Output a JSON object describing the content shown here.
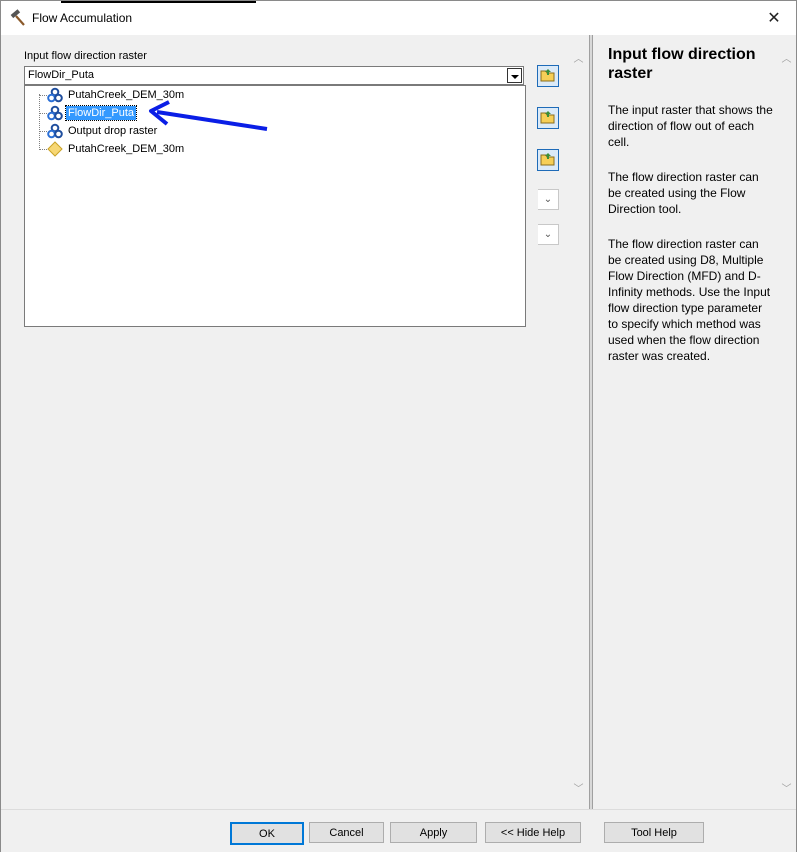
{
  "window": {
    "title": "Flow Accumulation",
    "icons": {
      "title": "hammer-icon",
      "close": "close-icon"
    }
  },
  "form": {
    "input_label": "Input flow direction raster",
    "input_value": "FlowDir_Puta",
    "dropdown_items": [
      {
        "label": "PutahCreek_DEM_30m",
        "icon": "raster-layer-icon",
        "selected": false
      },
      {
        "label": "FlowDir_Puta",
        "icon": "raster-layer-icon",
        "selected": true
      },
      {
        "label": "Output drop raster",
        "icon": "raster-layer-icon",
        "selected": false
      },
      {
        "label": "PutahCreek_DEM_30m",
        "icon": "raster-dataset-icon",
        "selected": false
      }
    ],
    "annotation": {
      "type": "arrow",
      "color": "#0a1ee6",
      "points_to": "FlowDir_Puta"
    }
  },
  "help": {
    "title": "Input flow direction raster",
    "paragraphs": [
      "The input raster that shows the direction of flow out of each cell.",
      "The flow direction raster can be created using the Flow Direction tool.",
      "The flow direction raster can be created using D8, Multiple Flow Direction (MFD) and D-Infinity methods. Use the Input flow direction type parameter to specify which method was used when the flow direction raster was created."
    ]
  },
  "buttons": {
    "ok": "OK",
    "cancel": "Cancel",
    "apply": "Apply",
    "hide_help": "<< Hide Help",
    "tool_help": "Tool Help"
  },
  "colors": {
    "selection": "#3399ff",
    "accent": "#0078d7",
    "arrow": "#0a1ee6"
  }
}
